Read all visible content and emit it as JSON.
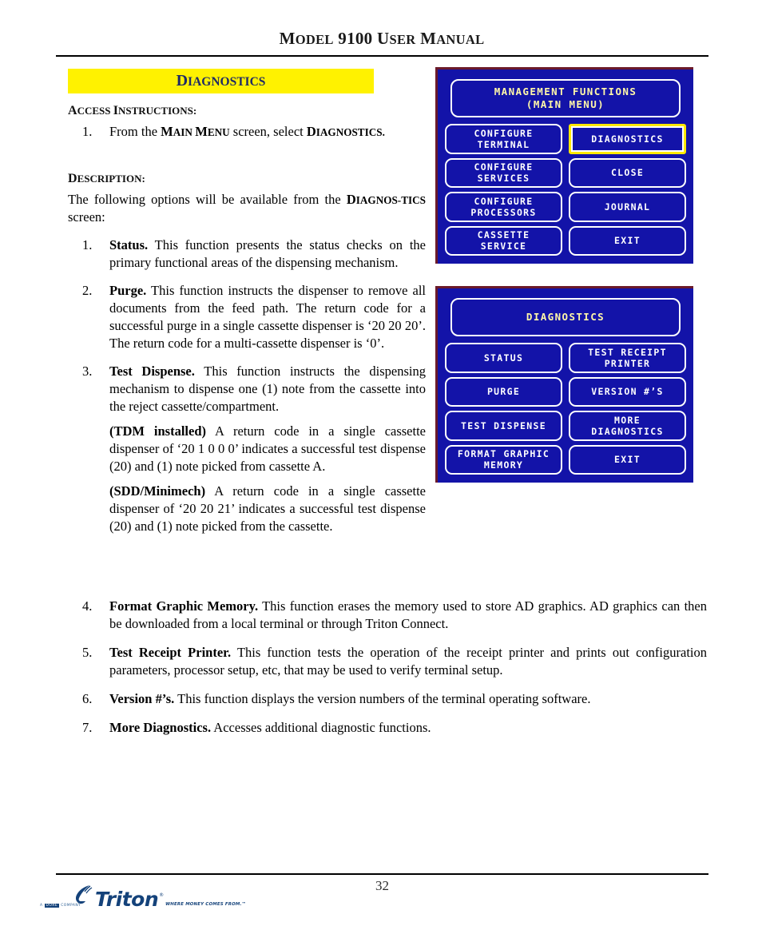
{
  "header": {
    "title_parts": [
      {
        "first": "M",
        "rest": "ODEL"
      },
      {
        "first": "9100",
        "rest": ""
      },
      {
        "first": "U",
        "rest": "SER"
      },
      {
        "first": "M",
        "rest": "ANUAL"
      }
    ],
    "title_plain": "MODEL 9100 USER MANUAL"
  },
  "section": {
    "banner_first": "D",
    "banner_rest": "IAGNOSTICS",
    "banner_plain": "DIAGNOSTICS",
    "banner_bg": "#FFF200",
    "banner_text_color": "#1F2A66"
  },
  "access": {
    "heading_first": "A",
    "heading_rest": "CCESS ",
    "heading_first2": "I",
    "heading_rest2": "NSTRUCTIONS:",
    "heading_plain": "ACCESS INSTRUCTIONS:",
    "item1_num": "1.",
    "item1_pre": "From the ",
    "item1_sc1_first": "M",
    "item1_sc1_rest": "AIN ",
    "item1_sc2_first": "M",
    "item1_sc2_rest": "ENU",
    "item1_mid": " screen, select ",
    "item1_sc3_first": "D",
    "item1_sc3_rest": "IAGNOSTICS.",
    "item1_plain": "From the MAIN MENU screen, select DIAGNOSTICS."
  },
  "description": {
    "heading_first": "D",
    "heading_rest": "ESCRIPTION:",
    "heading_plain": "DESCRIPTION:",
    "intro_pre": "The following options will be available from the ",
    "intro_sc_first": "D",
    "intro_sc_rest": "IAGNOS-",
    "intro_sc_rest2": "TICS",
    "intro_post": " screen:",
    "intro_plain": "The following options will be available from the DIAGNOSTICS screen:"
  },
  "items_column": [
    {
      "num": "1.",
      "term": "Status.",
      "body": " This function presents the status checks on the primary functional areas of the  dispensing mechanism."
    },
    {
      "num": "2.",
      "term": "Purge.",
      "body": " This function instructs the dispenser to remove all documents from the feed path. The return code for a successful purge in a single cassette dispenser is ‘20 20 20’. The return code for a multi-cassette dispenser is ‘0’."
    },
    {
      "num": "3.",
      "term": "Test Dispense.",
      "body": " This function instructs the dispensing mechanism to dispense one (1) note from the cassette into the reject cassette/compartment.",
      "sub": [
        {
          "term": "(TDM installed)",
          "body": "  A return code in a single cassette dispenser of ‘20 1 0 0 0’ indicates a successful test dispense (20) and (1) note picked from cassette A."
        },
        {
          "term": "(SDD/Minimech)",
          "body": "  A return code in a single cassette dispenser of ‘20 20 21’ indicates a successful test dispense (20) and (1) note picked from the cassette."
        }
      ]
    }
  ],
  "items_full": [
    {
      "num": "4.",
      "term": "Format Graphic Memory.",
      "body": " This function erases the memory used to store AD graphics. AD graphics can then be downloaded from a local terminal or through Triton Connect."
    },
    {
      "num": "5.",
      "term": "Test Receipt Printer.",
      "body": " This function tests the operation of the receipt printer and prints out configuration parameters, processor setup, etc, that may be used to verify terminal setup."
    },
    {
      "num": "6.",
      "term": "Version #’s.",
      "body": " This function displays the version numbers of the terminal operating software."
    },
    {
      "num": "7.",
      "term": "More Diagnostics.",
      "body": "  Accesses additional diagnostic functions."
    }
  ],
  "screens": {
    "bg_color": "#1313A8",
    "border_color": "#6B1A2A",
    "title_color": "#FFF7A8",
    "button_text_color": "#FFFFFF",
    "selected_border_color": "#FFE800",
    "main_menu": {
      "title": "MANAGEMENT FUNCTIONS\n(MAIN MENU)",
      "buttons": [
        {
          "label": "CONFIGURE\nTERMINAL",
          "selected": false
        },
        {
          "label": "DIAGNOSTICS",
          "selected": true
        },
        {
          "label": "CONFIGURE\nSERVICES",
          "selected": false
        },
        {
          "label": "CLOSE",
          "selected": false
        },
        {
          "label": "CONFIGURE\nPROCESSORS",
          "selected": false
        },
        {
          "label": "JOURNAL",
          "selected": false
        },
        {
          "label": "CASSETTE\nSERVICE",
          "selected": false
        },
        {
          "label": "EXIT",
          "selected": false
        }
      ]
    },
    "diagnostics": {
      "title": "DIAGNOSTICS",
      "buttons": [
        {
          "label": "STATUS",
          "selected": false
        },
        {
          "label": "TEST RECEIPT\nPRINTER",
          "selected": false
        },
        {
          "label": "PURGE",
          "selected": false
        },
        {
          "label": "VERSION #’S",
          "selected": false
        },
        {
          "label": "TEST DISPENSE",
          "selected": false
        },
        {
          "label": "MORE\nDIAGNOSTICS",
          "selected": false
        },
        {
          "label": "FORMAT GRAPHIC\nMEMORY",
          "selected": false
        },
        {
          "label": "EXIT",
          "selected": false
        }
      ]
    }
  },
  "footer": {
    "page_number": "32",
    "logo_word": "Triton",
    "logo_reg": "®",
    "logo_tagline": "WHERE MONEY COMES FROM.™",
    "logo_sub_pre": "A",
    "logo_sub_box": "DORE",
    "logo_sub_post": "COMPANY",
    "logo_color": "#14427A"
  }
}
